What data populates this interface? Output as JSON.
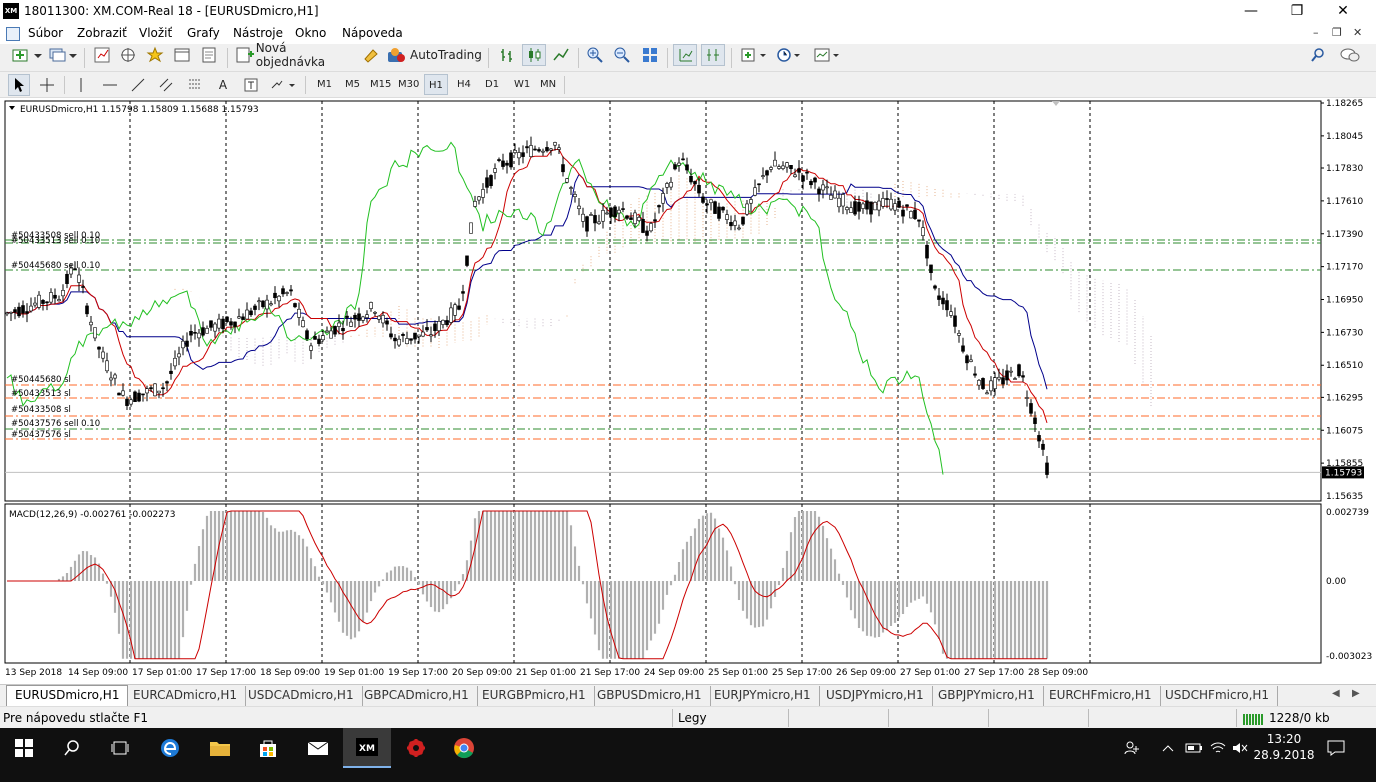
{
  "titlebar": {
    "title": "18011300: XM.COM-Real 18 - [EURUSDmicro,H1]",
    "logo": "XM"
  },
  "menu": {
    "items": [
      "Súbor",
      "Zobraziť",
      "Vložiť",
      "Grafy",
      "Nástroje",
      "Okno",
      "Nápoveda"
    ]
  },
  "toolbar": {
    "new_order": "Nová objednávka",
    "autotrading": "AutoTrading"
  },
  "timeframes": [
    "M1",
    "M5",
    "M15",
    "M30",
    "H1",
    "H4",
    "D1",
    "W1",
    "MN"
  ],
  "active_timeframe": "H1",
  "chart": {
    "header": "EURUSDmicro,H1  1.15798 1.15809 1.15688 1.15793",
    "price_labels": [
      "1.18265",
      "1.18045",
      "1.17830",
      "1.17610",
      "1.17390",
      "1.17170",
      "1.16950",
      "1.16730",
      "1.16510",
      "1.16295",
      "1.16075",
      "1.15855"
    ],
    "current_price": "1.15793",
    "bottom_price": "1.15635",
    "order_labels": [
      "#50433508 sell 0.10",
      "#50433513 sell 0.10",
      "#50445680 sell 0.10",
      "#50445680 sl",
      "#50433513 sl",
      "#50433508 sl",
      "#50437576 sell 0.10",
      "#50437576 sl"
    ],
    "macd_header": "MACD(12,26,9) -0.002761 -0.002273",
    "macd_labels": [
      "0.002739",
      "0.00",
      "-0.003023"
    ],
    "time_labels": [
      "13 Sep 2018",
      "14 Sep 09:00",
      "17 Sep 01:00",
      "17 Sep 17:00",
      "18 Sep 09:00",
      "19 Sep 01:00",
      "19 Sep 17:00",
      "20 Sep 09:00",
      "21 Sep 01:00",
      "21 Sep 17:00",
      "24 Sep 09:00",
      "25 Sep 01:00",
      "25 Sep 17:00",
      "26 Sep 09:00",
      "27 Sep 01:00",
      "27 Sep 17:00",
      "28 Sep 09:00"
    ]
  },
  "tabs": [
    "EURUSDmicro,H1",
    "EURCADmicro,H1",
    "USDCADmicro,H1",
    "GBPCADmicro,H1",
    "EURGBPmicro,H1",
    "GBPUSDmicro,H1",
    "EURJPYmicro,H1",
    "USDJPYmicro,H1",
    "GBPJPYmicro,H1",
    "EURCHFmicro,H1",
    "USDCHFmicro,H1"
  ],
  "active_tab": "EURUSDmicro,H1",
  "status": {
    "help": "Pre nápovedu stlačte F1",
    "profile": "Legy",
    "traffic": "1228/0 kb"
  },
  "taskbar": {
    "time": "13:20",
    "date": "28.9.2018"
  },
  "colors": {
    "bull": "#000000",
    "bear": "#000000",
    "tenkan": "#cc0000",
    "kijun": "#00008b",
    "chikou": "#22c022",
    "kumo": "#e0a070",
    "sell_line": "#2e8b2e",
    "sl_line": "#ff6a2a",
    "macd_hist": "#b0b0b0",
    "macd_signal": "#cc0000"
  }
}
